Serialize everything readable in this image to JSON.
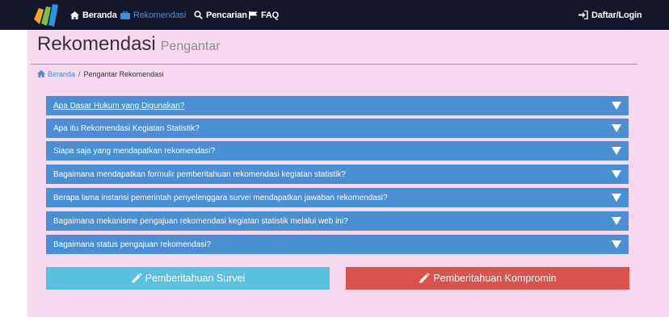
{
  "nav": {
    "home": "Beranda",
    "rekomendasi": "Rekomendasi",
    "search": "Pencarian",
    "faq": "FAQ",
    "login": "Daftar/Login"
  },
  "header": {
    "title": "Rekomendasi",
    "subtitle": "Pengantar"
  },
  "breadcrumb": {
    "home": "Beranda",
    "separator": "/",
    "current": "Pengantar Rekomendasi"
  },
  "faq": [
    "Apa Dasar Hukum yang Digunakan?",
    "Apa itu Rekomendasi Kegiatan Statistik?",
    "Siapa saja yang mendapatkan rekomendasi?",
    "Bagaimana mendapatkan formulir pemberitahuan rekomendasi kegiatan statistik?",
    "Berapa lama instansi pemerintah penyelenggara survei mendapatkan jawaban rekomendasi?",
    "Bagaimana mekanisme pengajuan rekomendasi kegiatan statistik melalui web ini?",
    "Bagaimana status pengajuan rekomendasi?"
  ],
  "buttons": {
    "survei": "Pemberitahuan Survei",
    "kompromin": "Pemberitahuan Kompromin"
  },
  "colors": {
    "navbar": "#15152b",
    "accent": "#3d8fd8",
    "panel": "#f7d9ef",
    "faq_row": "#4a8ed3",
    "btn_survei": "#5bc0de",
    "btn_kompromin": "#d9534f"
  }
}
